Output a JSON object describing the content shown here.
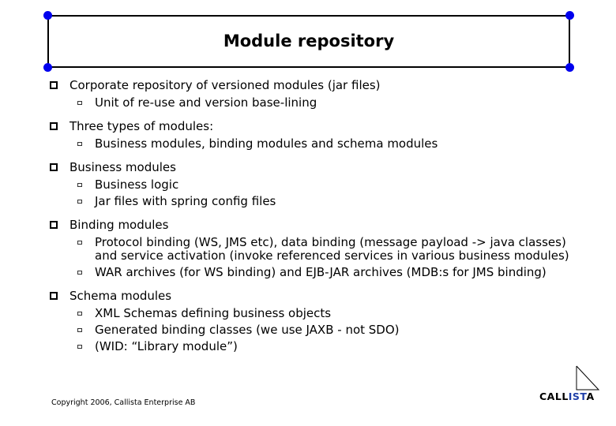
{
  "slide": {
    "title": "Module repository",
    "bullets": [
      {
        "text": "Corporate repository of versioned modules (jar files)",
        "sub": [
          "Unit of re-use and version base-lining"
        ]
      },
      {
        "text": "Three types of modules:",
        "sub": [
          "Business modules, binding modules and schema modules"
        ]
      },
      {
        "text": "Business modules",
        "sub": [
          "Business logic",
          "Jar files with spring config files"
        ]
      },
      {
        "text": "Binding modules",
        "sub": [
          "Protocol binding (WS, JMS etc), data binding (message payload -> java classes) and service activation (invoke referenced services in various business modules)",
          "WAR archives (for WS binding) and EJB-JAR archives (MDB:s for JMS binding)"
        ]
      },
      {
        "text": "Schema modules",
        "sub": [
          "XML Schemas defining business objects",
          "Generated binding classes (we use JAXB - not SDO)",
          "(WID: “Library module”)"
        ]
      }
    ],
    "footer": {
      "copyright": "Copyright 2006, Callista Enterprise AB"
    },
    "logo": {
      "part1": "CALL",
      "part2": "IST",
      "part3": "A",
      "accent_color": "#1f3fa8"
    },
    "handle_color": "#0000ee"
  }
}
